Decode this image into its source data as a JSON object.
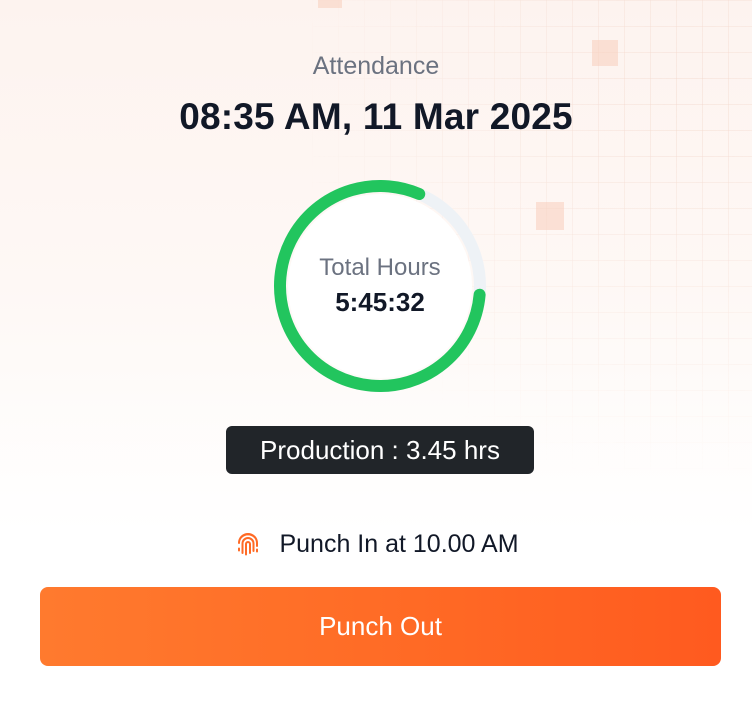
{
  "attendance": {
    "title": "Attendance",
    "datetime": "08:35 AM, 11 Mar 2025"
  },
  "total_hours": {
    "label": "Total Hours",
    "value": "5:45:32",
    "progress_fraction": 0.8,
    "progress_color": "#22c55e",
    "track_color": "#eef2f6"
  },
  "production": {
    "text": "Production : 3.45 hrs"
  },
  "punch_in": {
    "icon": "fingerprint-icon",
    "icon_color": "#ff6a25",
    "text": "Punch In at  10.00 AM"
  },
  "actions": {
    "punch_out_label": "Punch Out",
    "accent_color": "#ff6a25"
  }
}
